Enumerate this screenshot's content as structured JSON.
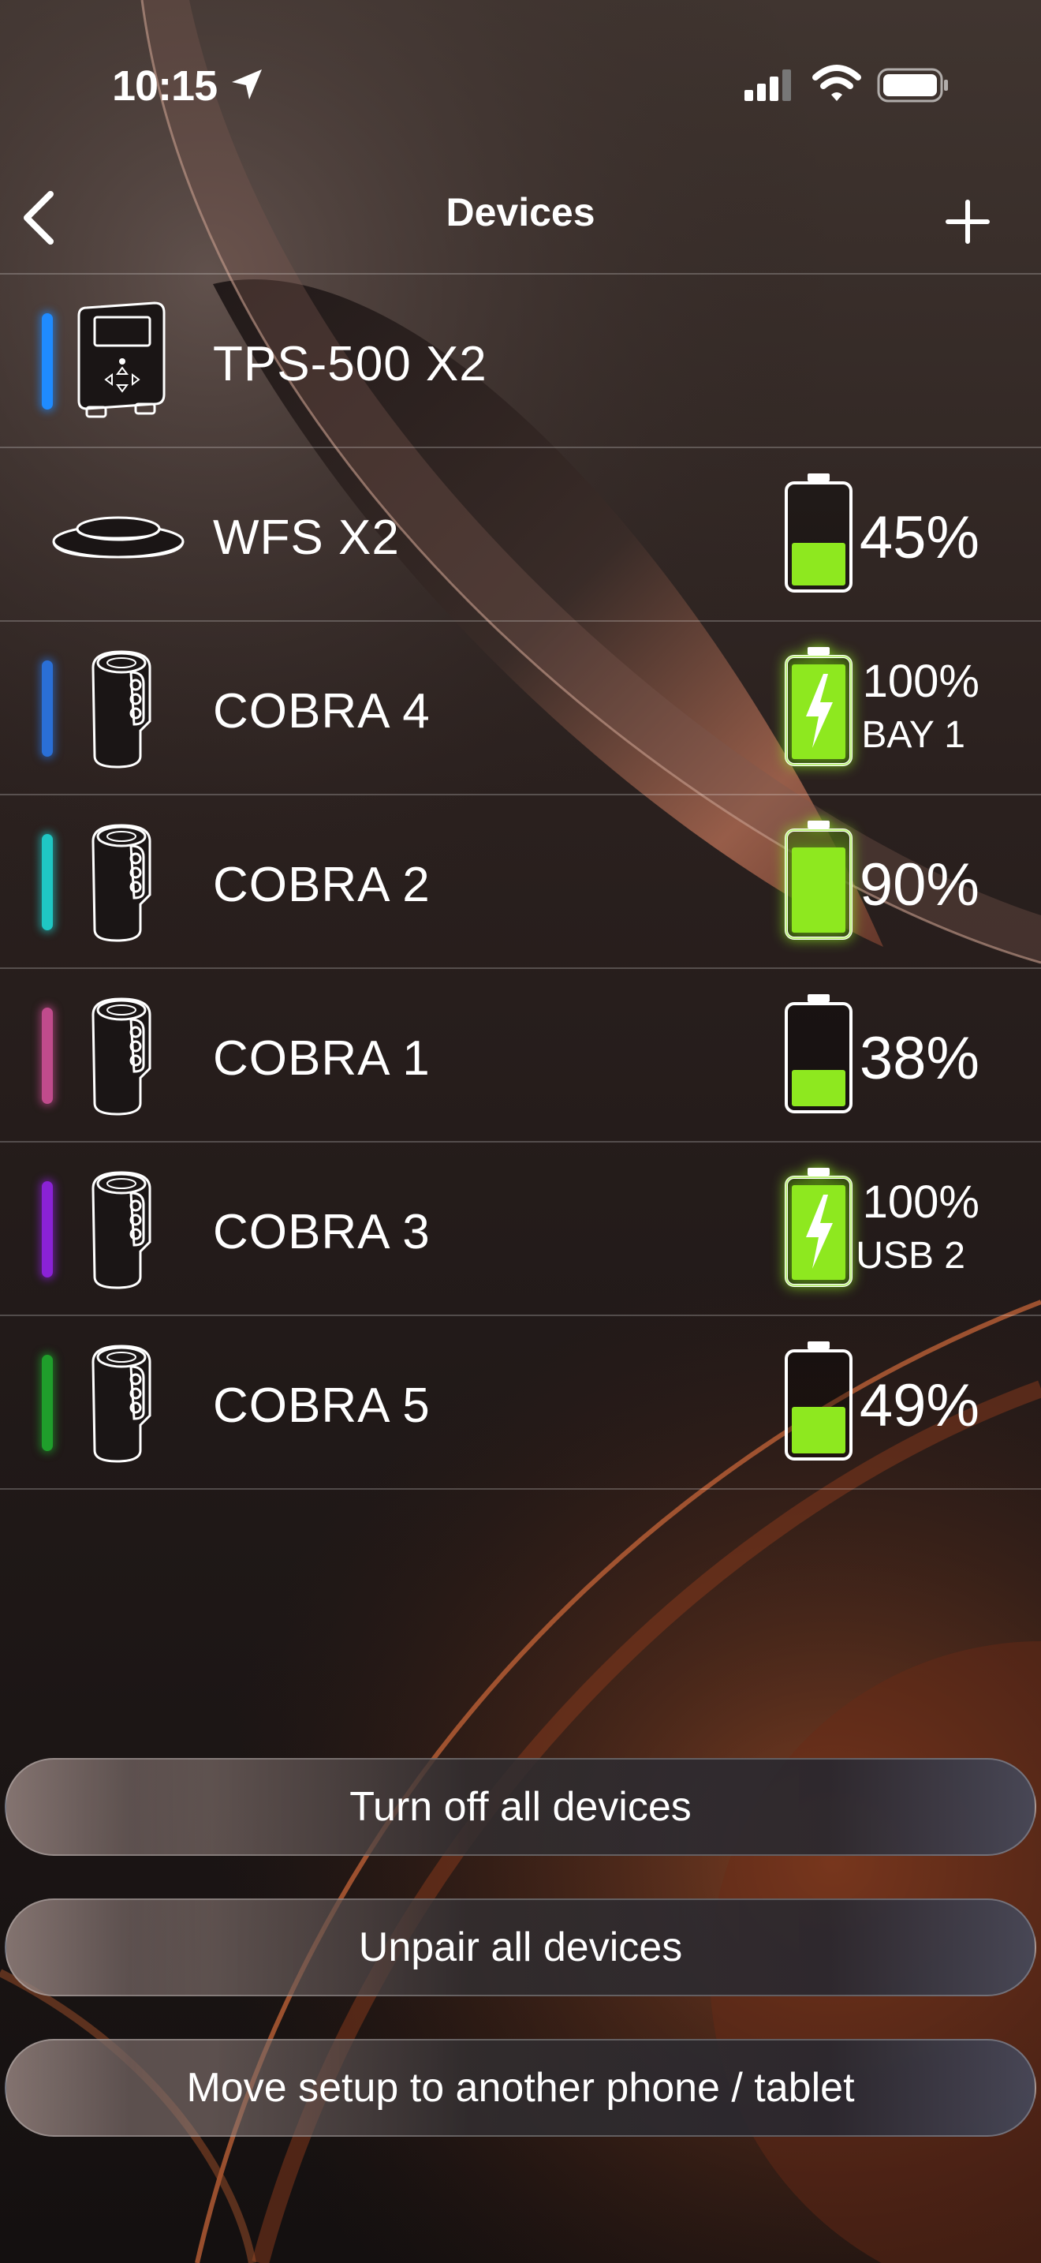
{
  "status_bar": {
    "time": "10:15"
  },
  "nav": {
    "title": "Devices",
    "back_icon": "chevron-left-icon",
    "add_icon": "plus-icon"
  },
  "devices": [
    {
      "name": "TPS-500 X2",
      "icon": "control-unit-icon",
      "color": "#1f8bff",
      "battery": null
    },
    {
      "name": "WFS X2",
      "icon": "foot-switch-icon",
      "color": null,
      "battery": {
        "level": 0.45,
        "charging": false,
        "percent": "45%",
        "sub": null
      }
    },
    {
      "name": "COBRA 4",
      "icon": "cobra-pen-icon",
      "color": "#2a6fd6",
      "battery": {
        "level": 1.0,
        "charging": true,
        "percent": "100%",
        "sub": "BAY 1"
      }
    },
    {
      "name": "COBRA 2",
      "icon": "cobra-pen-icon",
      "color": "#1fc7c4",
      "battery": {
        "level": 0.9,
        "charging": false,
        "percent": "90%",
        "sub": null
      }
    },
    {
      "name": "COBRA 1",
      "icon": "cobra-pen-icon",
      "color": "#c04b8c",
      "battery": {
        "level": 0.38,
        "charging": false,
        "percent": "38%",
        "sub": null
      }
    },
    {
      "name": "COBRA 3",
      "icon": "cobra-pen-icon",
      "color": "#8a22d6",
      "battery": {
        "level": 1.0,
        "charging": true,
        "percent": "100%",
        "sub": "USB 2"
      }
    },
    {
      "name": "COBRA 5",
      "icon": "cobra-pen-icon",
      "color": "#1f9e2b",
      "battery": {
        "level": 0.49,
        "charging": false,
        "percent": "49%",
        "sub": null
      }
    }
  ],
  "actions": {
    "turn_off": "Turn off all devices",
    "unpair": "Unpair all devices",
    "move_setup": "Move setup to another phone / tablet"
  },
  "colors": {
    "battery_green": "#8ee81f"
  }
}
